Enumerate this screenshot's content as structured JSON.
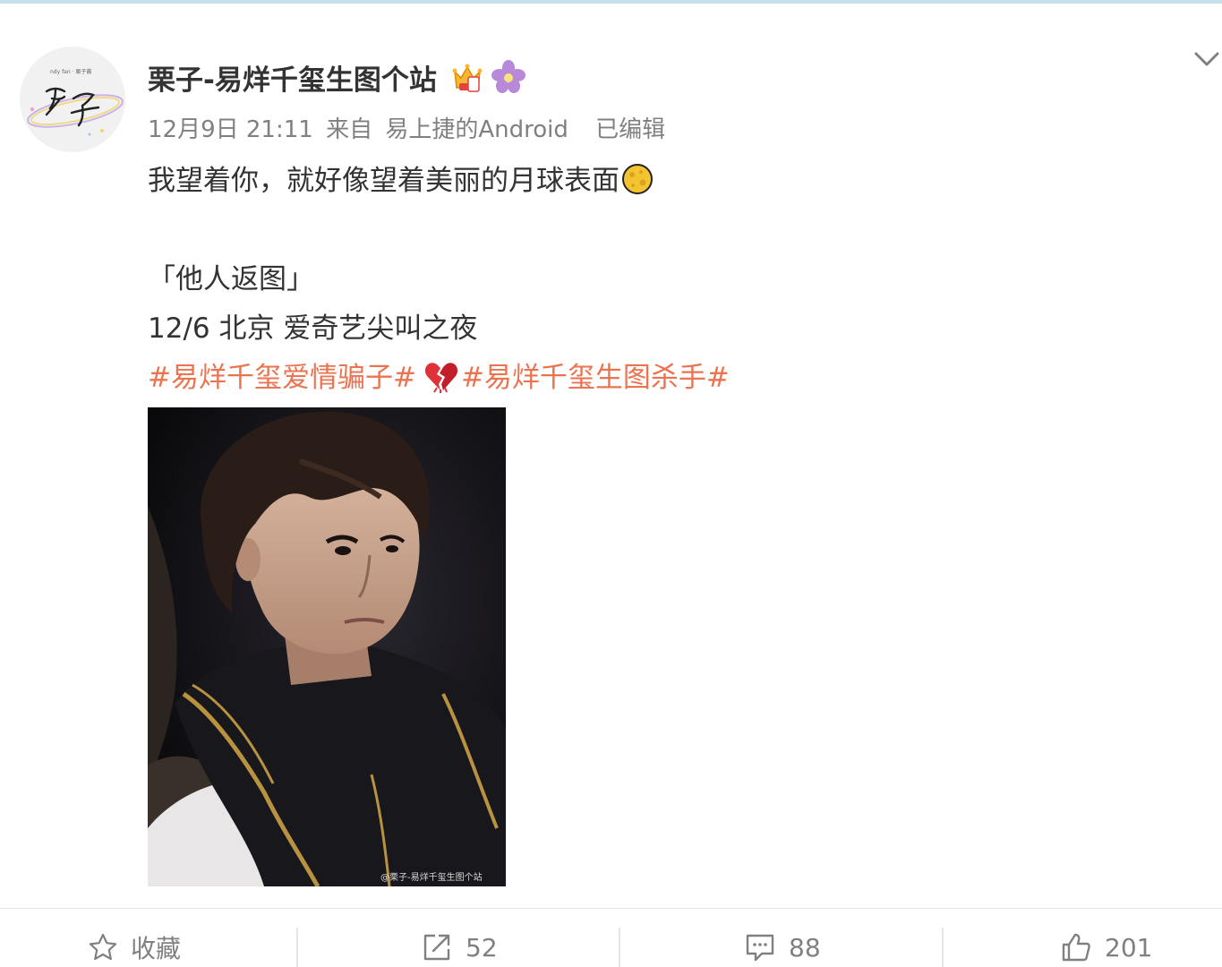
{
  "post": {
    "author": {
      "name": "栗子-易烊千玺生图个站",
      "avatar_text": "栗子",
      "badges": [
        "crown-badge-icon",
        "flower-badge-icon"
      ]
    },
    "meta": {
      "time": "12月9日 21:11",
      "source_prefix": "来自",
      "source": "易上捷的Android",
      "edited": "已编辑"
    },
    "text": {
      "line1": "我望着你，就好像望着美丽的月球表面",
      "line1_emoji": "moon-emoji-icon",
      "line2": "「他人返图」",
      "line3": "12/6 北京  爱奇艺尖叫之夜"
    },
    "hashtags": {
      "tag1": "#易烊千玺爱情骗子#",
      "separator_emoji": "broken-heart-emoji-icon",
      "tag2": "#易烊千玺生图杀手#",
      "color": "#eb7350"
    },
    "image": {
      "watermark": "@栗子-易烊千玺生图个站"
    },
    "actions": {
      "favorite_label": "收藏",
      "repost_count": "52",
      "comment_count": "88",
      "like_count": "201"
    }
  }
}
